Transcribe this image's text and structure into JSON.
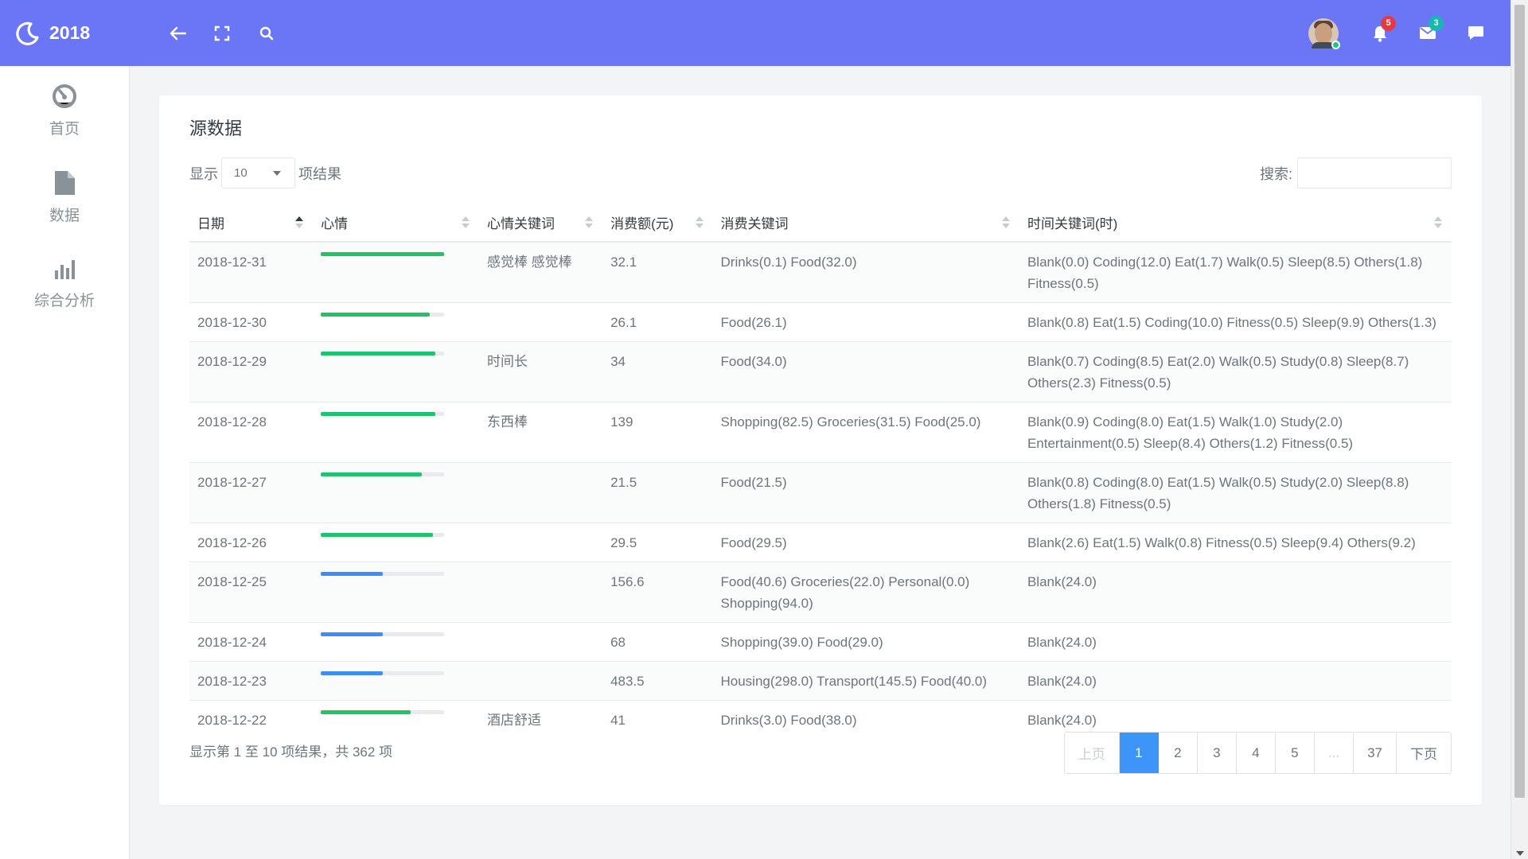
{
  "app": {
    "title": "2018"
  },
  "sidebar": {
    "items": [
      {
        "label": "首页",
        "icon": "dashboard-icon"
      },
      {
        "label": "数据",
        "icon": "file-icon"
      },
      {
        "label": "综合分析",
        "icon": "bar-chart-icon"
      }
    ]
  },
  "topbar": {
    "notifications_count": "5",
    "messages_count": "3",
    "accent": "#6b76f6"
  },
  "card": {
    "title": "源数据",
    "show_prefix": "显示",
    "length_value": "10",
    "show_suffix": "项结果",
    "search_label": "搜索:",
    "info": "显示第 1 至 10 项结果，共 362 项"
  },
  "table": {
    "headers": [
      "日期",
      "心情",
      "心情关键词",
      "消费额(元)",
      "消费关键词",
      "时间关键词(时)"
    ],
    "rows": [
      {
        "date": "2018-12-31",
        "mood": 1.0,
        "mood_color": "#1ec36b",
        "mood_kw": "感觉棒 感觉棒",
        "amount": "32.1",
        "spend_kw": "Drinks(0.1) Food(32.0)",
        "time_kw": "Blank(0.0) Coding(12.0) Eat(1.7) Walk(0.5) Sleep(8.5) Others(1.8) Fitness(0.5)"
      },
      {
        "date": "2018-12-30",
        "mood": 0.88,
        "mood_color": "#1ec36b",
        "mood_kw": "",
        "amount": "26.1",
        "spend_kw": "Food(26.1)",
        "time_kw": "Blank(0.8) Eat(1.5) Coding(10.0) Fitness(0.5) Sleep(9.9) Others(1.3)"
      },
      {
        "date": "2018-12-29",
        "mood": 0.93,
        "mood_color": "#1ec36b",
        "mood_kw": "时间长",
        "amount": "34",
        "spend_kw": "Food(34.0)",
        "time_kw": "Blank(0.7) Coding(8.5) Eat(2.0) Walk(0.5) Study(0.8) Sleep(8.7) Others(2.3) Fitness(0.5)"
      },
      {
        "date": "2018-12-28",
        "mood": 0.93,
        "mood_color": "#1ec36b",
        "mood_kw": "东西棒",
        "amount": "139",
        "spend_kw": "Shopping(82.5) Groceries(31.5) Food(25.0)",
        "time_kw": "Blank(0.9) Coding(8.0) Eat(1.5) Walk(1.0) Study(2.0) Entertainment(0.5) Sleep(8.4) Others(1.2) Fitness(0.5)"
      },
      {
        "date": "2018-12-27",
        "mood": 0.82,
        "mood_color": "#1ec36b",
        "mood_kw": "",
        "amount": "21.5",
        "spend_kw": "Food(21.5)",
        "time_kw": "Blank(0.8) Coding(8.0) Eat(1.5) Walk(0.5) Study(2.0) Sleep(8.8) Others(1.8) Fitness(0.5)"
      },
      {
        "date": "2018-12-26",
        "mood": 0.91,
        "mood_color": "#1ec36b",
        "mood_kw": "",
        "amount": "29.5",
        "spend_kw": "Food(29.5)",
        "time_kw": "Blank(2.6) Eat(1.5) Walk(0.8) Fitness(0.5) Sleep(9.4) Others(9.2)"
      },
      {
        "date": "2018-12-25",
        "mood": 0.5,
        "mood_color": "#3e8df5",
        "mood_kw": "",
        "amount": "156.6",
        "spend_kw": "Food(40.6) Groceries(22.0) Personal(0.0) Shopping(94.0)",
        "time_kw": "Blank(24.0)"
      },
      {
        "date": "2018-12-24",
        "mood": 0.5,
        "mood_color": "#3e8df5",
        "mood_kw": "",
        "amount": "68",
        "spend_kw": "Shopping(39.0) Food(29.0)",
        "time_kw": "Blank(24.0)"
      },
      {
        "date": "2018-12-23",
        "mood": 0.5,
        "mood_color": "#3e8df5",
        "mood_kw": "",
        "amount": "483.5",
        "spend_kw": "Housing(298.0) Transport(145.5) Food(40.0)",
        "time_kw": "Blank(24.0)"
      },
      {
        "date": "2018-12-22",
        "mood": 0.73,
        "mood_color": "#1ec36b",
        "mood_kw": "酒店舒适",
        "amount": "41",
        "spend_kw": "Drinks(3.0) Food(38.0)",
        "time_kw": "Blank(24.0)"
      }
    ]
  },
  "pagination": {
    "prev": "上页",
    "pages": [
      "1",
      "2",
      "3",
      "4",
      "5",
      "...",
      "37"
    ],
    "active": "1",
    "next": "下页"
  }
}
